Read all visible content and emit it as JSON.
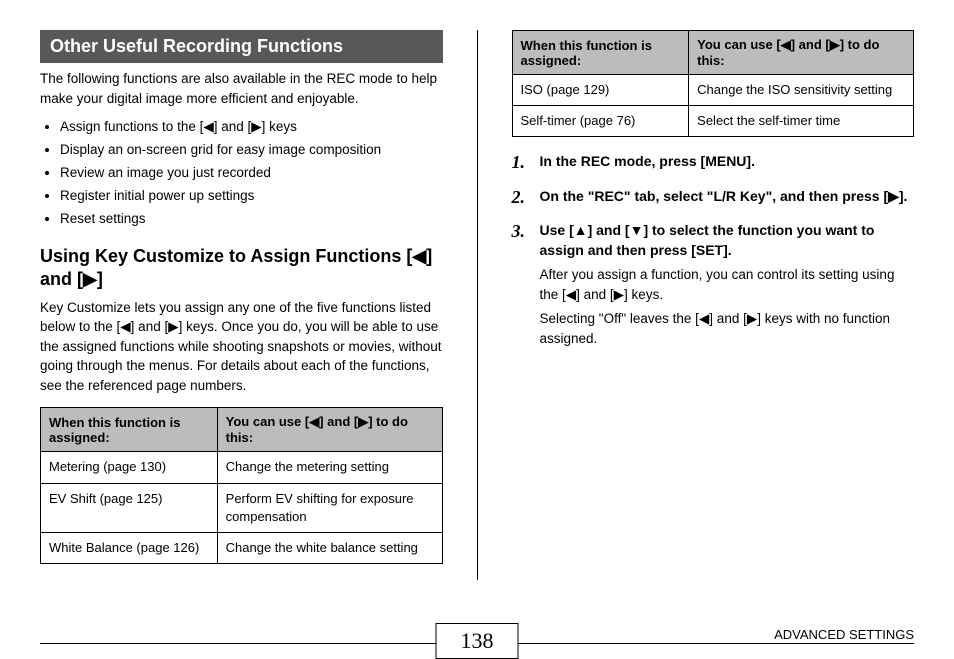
{
  "section_title": "Other Useful Recording Functions",
  "intro": "The following functions are also available in the REC mode to help make your digital image more efficient and enjoyable.",
  "bullets": [
    "Assign functions to the [◀] and [▶] keys",
    "Display an on-screen grid for easy image composition",
    "Review an image you just recorded",
    "Register initial power up settings",
    "Reset settings"
  ],
  "subheading": "Using Key Customize to Assign Functions [◀] and [▶]",
  "sub_intro": "Key Customize lets you assign any one of the five functions listed below to the [◀] and [▶] keys. Once you do, you will be able to use the assigned functions while shooting snapshots or movies, without going through the menus. For details about each of the functions, see the referenced page numbers.",
  "table_header_a": "When this function is assigned:",
  "table_header_b": "You can use [◀] and [▶] to do this:",
  "table_left": [
    {
      "a": "Metering (page 130)",
      "b": "Change the metering setting"
    },
    {
      "a": "EV Shift (page 125)",
      "b": "Perform EV shifting for exposure compensation"
    },
    {
      "a": "White Balance (page 126)",
      "b": "Change the white balance setting"
    }
  ],
  "table_right": [
    {
      "a": "ISO (page 129)",
      "b": "Change the ISO sensitivity setting"
    },
    {
      "a": "Self-timer (page 76)",
      "b": "Select the self-timer time"
    }
  ],
  "steps": [
    {
      "head": "In the REC mode, press [MENU]."
    },
    {
      "head": "On the \"REC\" tab, select \"L/R Key\", and then press [▶]."
    },
    {
      "head": "Use [▲] and [▼] to select the function you want to assign and then press [SET].",
      "body1": "After you assign a function, you can control its setting using the [◀] and [▶] keys.",
      "body2": "Selecting \"Off\" leaves the [◀] and [▶] keys with no function assigned."
    }
  ],
  "footer_section": "ADVANCED SETTINGS",
  "page_number": "138"
}
